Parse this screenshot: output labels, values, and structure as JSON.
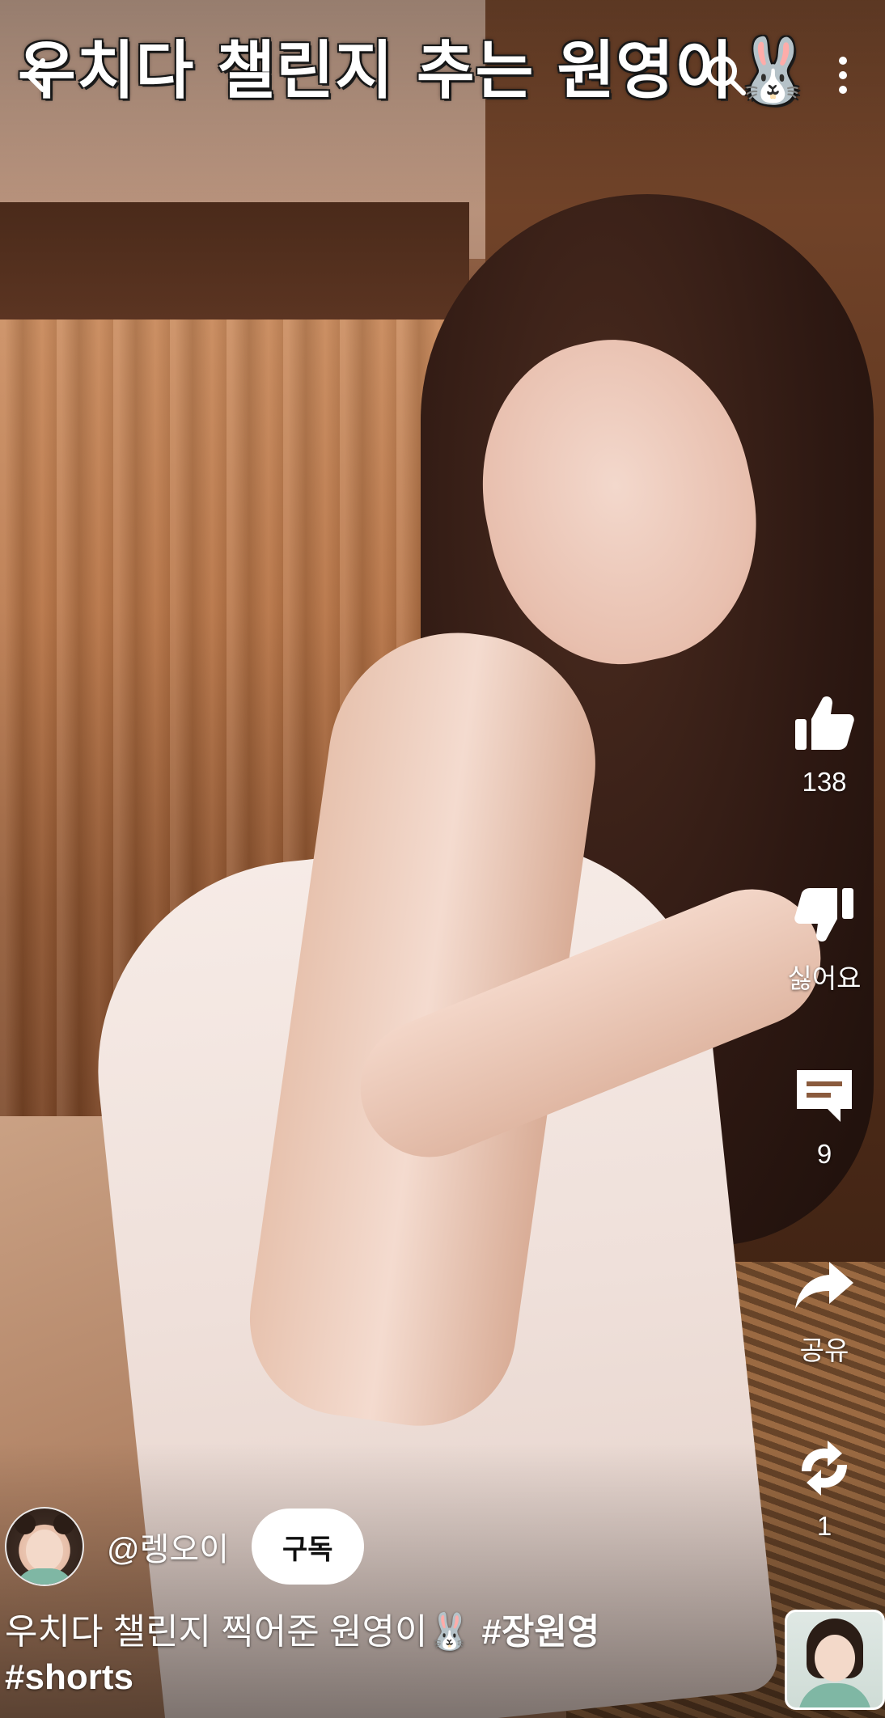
{
  "video": {
    "caption": "우치다 챌린지 추는 원영이🐰"
  },
  "top_bar": {
    "back_icon": "arrow-left-icon",
    "search_icon": "search-icon",
    "more_icon": "more-vertical-icon"
  },
  "actions": {
    "like": {
      "icon": "thumbs-up-icon",
      "label": "138"
    },
    "dislike": {
      "icon": "thumbs-down-icon",
      "label": "싫어요"
    },
    "comments": {
      "icon": "comment-icon",
      "label": "9"
    },
    "share": {
      "icon": "share-icon",
      "label": "공유"
    },
    "remix": {
      "icon": "remix-icon",
      "label": "1"
    }
  },
  "channel": {
    "handle": "@렝오이",
    "subscribe_label": "구독"
  },
  "description": {
    "text": "우치다 챌린지 찍어준 원영이🐰 ",
    "hashtags": [
      "#장원영",
      "#shorts"
    ]
  },
  "colors": {
    "subscribe_bg": "#ffffff",
    "text": "#ffffff"
  }
}
